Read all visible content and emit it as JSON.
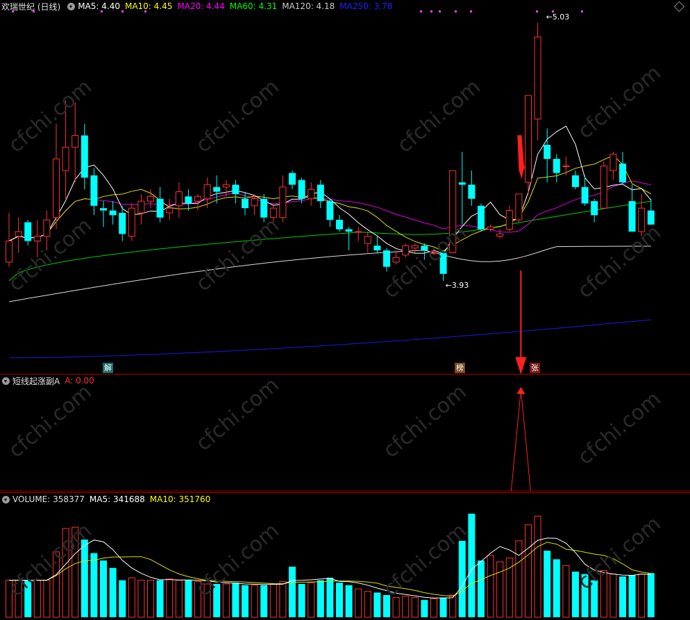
{
  "main": {
    "stock_name": "欢瑞世纪 (日线)",
    "ma": [
      {
        "label": "MA5: 4.40",
        "color": "#ffffff"
      },
      {
        "label": "MA10: 4.45",
        "color": "#ffff00"
      },
      {
        "label": "MA20: 4.44",
        "color": "#ff00ff"
      },
      {
        "label": "MA60: 4.31",
        "color": "#00ff00"
      },
      {
        "label": "MA120: 4.18",
        "color": "#cccccc"
      },
      {
        "label": "MA250: 3.78",
        "color": "#0000ff"
      }
    ],
    "high_label": "5.03",
    "low_label": "3.93",
    "markers": {
      "jie": "解",
      "bang": "榜",
      "zhang": "张"
    }
  },
  "indicator": {
    "name": "短线起涨副A",
    "value": "A: 0.00"
  },
  "volume": {
    "label": "VOLUME: 358377",
    "ma5": "MA5: 341688",
    "ma10": "MA10: 351760"
  },
  "watermark": "cfchi.com",
  "colors": {
    "up": "#ff3232",
    "down": "#00ffff",
    "bg": "#000000",
    "axis": "#b40000"
  },
  "chart_data": {
    "type": "candlestick",
    "price_range": [
      3.93,
      5.03
    ],
    "candles": [
      {
        "o": 4.01,
        "h": 4.22,
        "l": 3.99,
        "c": 4.1
      },
      {
        "o": 4.12,
        "h": 4.2,
        "l": 4.05,
        "c": 4.14
      },
      {
        "o": 4.18,
        "h": 4.19,
        "l": 4.08,
        "c": 4.1
      },
      {
        "o": 4.1,
        "h": 4.19,
        "l": 4.03,
        "c": 4.12
      },
      {
        "o": 4.12,
        "h": 4.23,
        "l": 4.06,
        "c": 4.19
      },
      {
        "o": 4.2,
        "h": 4.6,
        "l": 4.15,
        "c": 4.45
      },
      {
        "o": 4.4,
        "h": 4.7,
        "l": 4.28,
        "c": 4.5
      },
      {
        "o": 4.5,
        "h": 4.69,
        "l": 4.35,
        "c": 4.55
      },
      {
        "o": 4.55,
        "h": 4.6,
        "l": 4.32,
        "c": 4.37
      },
      {
        "o": 4.38,
        "h": 4.41,
        "l": 4.21,
        "c": 4.25
      },
      {
        "o": 4.24,
        "h": 4.27,
        "l": 4.16,
        "c": 4.23
      },
      {
        "o": 4.23,
        "h": 4.27,
        "l": 4.17,
        "c": 4.21
      },
      {
        "o": 4.22,
        "h": 4.25,
        "l": 4.1,
        "c": 4.13
      },
      {
        "o": 4.12,
        "h": 4.26,
        "l": 4.1,
        "c": 4.24
      },
      {
        "o": 4.22,
        "h": 4.3,
        "l": 4.17,
        "c": 4.27
      },
      {
        "o": 4.27,
        "h": 4.32,
        "l": 4.24,
        "c": 4.29
      },
      {
        "o": 4.28,
        "h": 4.33,
        "l": 4.18,
        "c": 4.2
      },
      {
        "o": 4.22,
        "h": 4.28,
        "l": 4.19,
        "c": 4.24
      },
      {
        "o": 4.25,
        "h": 4.35,
        "l": 4.2,
        "c": 4.31
      },
      {
        "o": 4.29,
        "h": 4.32,
        "l": 4.23,
        "c": 4.26
      },
      {
        "o": 4.27,
        "h": 4.3,
        "l": 4.23,
        "c": 4.29
      },
      {
        "o": 4.28,
        "h": 4.37,
        "l": 4.24,
        "c": 4.34
      },
      {
        "o": 4.33,
        "h": 4.38,
        "l": 4.26,
        "c": 4.31
      },
      {
        "o": 4.33,
        "h": 4.36,
        "l": 4.29,
        "c": 4.34
      },
      {
        "o": 4.34,
        "h": 4.36,
        "l": 4.26,
        "c": 4.3
      },
      {
        "o": 4.28,
        "h": 4.31,
        "l": 4.21,
        "c": 4.24
      },
      {
        "o": 4.25,
        "h": 4.3,
        "l": 4.21,
        "c": 4.28
      },
      {
        "o": 4.28,
        "h": 4.3,
        "l": 4.18,
        "c": 4.2
      },
      {
        "o": 4.2,
        "h": 4.25,
        "l": 4.18,
        "c": 4.24
      },
      {
        "o": 4.2,
        "h": 4.38,
        "l": 4.18,
        "c": 4.33
      },
      {
        "o": 4.39,
        "h": 4.4,
        "l": 4.32,
        "c": 4.34
      },
      {
        "o": 4.36,
        "h": 4.37,
        "l": 4.26,
        "c": 4.28
      },
      {
        "o": 4.28,
        "h": 4.35,
        "l": 4.25,
        "c": 4.32
      },
      {
        "o": 4.34,
        "h": 4.36,
        "l": 4.24,
        "c": 4.27
      },
      {
        "o": 4.27,
        "h": 4.28,
        "l": 4.16,
        "c": 4.19
      },
      {
        "o": 4.19,
        "h": 4.21,
        "l": 4.14,
        "c": 4.15
      },
      {
        "o": 4.15,
        "h": 4.16,
        "l": 4.06,
        "c": 4.14
      },
      {
        "o": 4.14,
        "h": 4.16,
        "l": 4.1,
        "c": 4.14
      },
      {
        "o": 4.09,
        "h": 4.14,
        "l": 4.05,
        "c": 4.12
      },
      {
        "o": 4.08,
        "h": 4.12,
        "l": 4.05,
        "c": 4.06
      },
      {
        "o": 4.06,
        "h": 4.07,
        "l": 3.97,
        "c": 3.99
      },
      {
        "o": 4.01,
        "h": 4.06,
        "l": 4.0,
        "c": 4.03
      },
      {
        "o": 4.04,
        "h": 4.09,
        "l": 4.03,
        "c": 4.08
      },
      {
        "o": 4.07,
        "h": 4.09,
        "l": 4.05,
        "c": 4.08
      },
      {
        "o": 4.08,
        "h": 4.09,
        "l": 4.02,
        "c": 4.06
      },
      {
        "o": 4.05,
        "h": 4.07,
        "l": 4.04,
        "c": 4.05
      },
      {
        "o": 4.05,
        "h": 4.06,
        "l": 3.93,
        "c": 3.96
      },
      {
        "o": 4.05,
        "h": 4.4,
        "l": 4.05,
        "c": 4.4
      },
      {
        "o": 4.35,
        "h": 4.48,
        "l": 4.17,
        "c": 4.34
      },
      {
        "o": 4.34,
        "h": 4.4,
        "l": 4.25,
        "c": 4.28
      },
      {
        "o": 4.25,
        "h": 4.26,
        "l": 4.14,
        "c": 4.15
      },
      {
        "o": 4.15,
        "h": 4.17,
        "l": 4.14,
        "c": 4.16
      },
      {
        "o": 4.12,
        "h": 4.15,
        "l": 4.11,
        "c": 4.13
      },
      {
        "o": 4.15,
        "h": 4.25,
        "l": 4.14,
        "c": 4.23
      },
      {
        "o": 4.19,
        "h": 4.3,
        "l": 4.18,
        "c": 4.3
      },
      {
        "o": 4.35,
        "h": 4.72,
        "l": 4.3,
        "c": 4.72
      },
      {
        "o": 4.62,
        "h": 5.03,
        "l": 4.53,
        "c": 4.97
      },
      {
        "o": 4.51,
        "h": 4.58,
        "l": 4.35,
        "c": 4.45
      },
      {
        "o": 4.45,
        "h": 4.47,
        "l": 4.35,
        "c": 4.39
      },
      {
        "o": 4.42,
        "h": 4.46,
        "l": 4.38,
        "c": 4.42
      },
      {
        "o": 4.38,
        "h": 4.4,
        "l": 4.32,
        "c": 4.33
      },
      {
        "o": 4.33,
        "h": 4.38,
        "l": 4.25,
        "c": 4.26
      },
      {
        "o": 4.27,
        "h": 4.28,
        "l": 4.18,
        "c": 4.21
      },
      {
        "o": 4.24,
        "h": 4.44,
        "l": 4.24,
        "c": 4.42
      },
      {
        "o": 4.4,
        "h": 4.48,
        "l": 4.36,
        "c": 4.47
      },
      {
        "o": 4.43,
        "h": 4.48,
        "l": 4.34,
        "c": 4.35
      },
      {
        "o": 4.27,
        "h": 4.34,
        "l": 4.2,
        "c": 4.14
      },
      {
        "o": 4.14,
        "h": 4.3,
        "l": 4.12,
        "c": 4.24
      },
      {
        "o": 4.23,
        "h": 4.28,
        "l": 4.17,
        "c": 4.17
      }
    ],
    "volume": [
      300000,
      300000,
      300000,
      300000,
      300000,
      530000,
      720000,
      730000,
      630000,
      520000,
      460000,
      400000,
      300000,
      320000,
      300000,
      300000,
      300000,
      310000,
      300000,
      300000,
      290000,
      270000,
      270000,
      270000,
      280000,
      260000,
      260000,
      260000,
      270000,
      290000,
      410000,
      270000,
      280000,
      300000,
      320000,
      280000,
      260000,
      230000,
      210000,
      200000,
      180000,
      160000,
      170000,
      160000,
      140000,
      150000,
      160000,
      180000,
      620000,
      840000,
      460000,
      500000,
      450000,
      480000,
      620000,
      750000,
      820000,
      540000,
      470000,
      420000,
      370000,
      350000,
      300000,
      380000,
      350000,
      330000,
      340000,
      350000,
      358377
    ],
    "signal_index": 54
  }
}
